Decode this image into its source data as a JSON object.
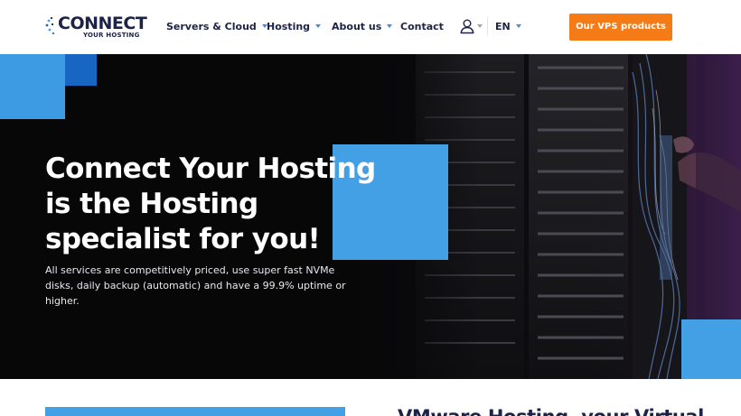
{
  "brand": {
    "name": "CONNECT",
    "tagline": "YOUR HOSTING",
    "colors": {
      "navy": "#1c2347",
      "accent_blue": "#44a0e4",
      "dark_blue": "#1766c2",
      "orange": "#f47b16"
    }
  },
  "nav": {
    "items": [
      {
        "label": "Servers & Cloud",
        "has_dropdown": true
      },
      {
        "label": "Hosting",
        "has_dropdown": true
      },
      {
        "label": "About us",
        "has_dropdown": true
      },
      {
        "label": "Contact",
        "has_dropdown": false
      }
    ],
    "account_icon": "user-icon",
    "language": "EN",
    "cta_label": "Our VPS products"
  },
  "hero": {
    "title_lines": [
      "Connect Your Hosting",
      "is the Hosting",
      "specialist for you!"
    ],
    "subtitle": "All services are competitively priced, use super fast NVMe disks, daily backup (automatic) and have a 99.9% uptime or higher.",
    "background": "server-rack-photo"
  },
  "section": {
    "heading": "VMware Hosting, your Virtual"
  }
}
